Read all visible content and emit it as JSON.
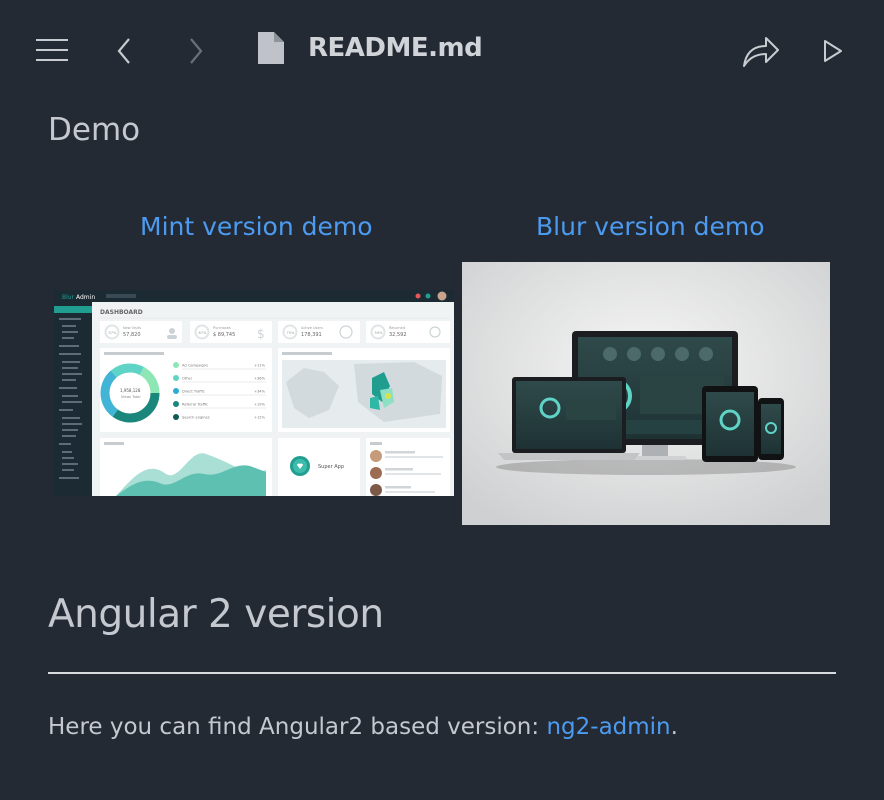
{
  "toolbar": {
    "title": "README.md",
    "icons": [
      "menu-icon",
      "back-icon",
      "forward-icon",
      "file-icon",
      "share-icon",
      "play-icon"
    ]
  },
  "content": {
    "demo_heading": "Demo",
    "mint_link": "Mint version demo",
    "blur_link": "Blur version demo",
    "mint_image": {
      "logo_a": "Blur",
      "logo_b": "Admin",
      "page": "DASHBOARD",
      "stat_cards": [
        {
          "label": "New Visits",
          "value": "57,820",
          "percent": "57%"
        },
        {
          "label": "Purchases",
          "value": "$ 89,745",
          "percent": "67%"
        },
        {
          "label": "Active Users",
          "value": "178,391",
          "percent": "70%"
        },
        {
          "label": "Returned",
          "value": "32,592",
          "percent": "59%"
        }
      ],
      "donut_center_value": "1,958,128",
      "donut_center_label": "Views Total",
      "legend": [
        {
          "label": "Ad Campaigns",
          "value": "+11%"
        },
        {
          "label": "Other",
          "value": "+36%"
        },
        {
          "label": "Direct Traffic",
          "value": "+34%"
        },
        {
          "label": "Referral Traffic",
          "value": "+19%"
        },
        {
          "label": "Search engines",
          "value": "+12%"
        }
      ],
      "promo_label": "Super App",
      "colors": {
        "sidebar": "#1b2a33",
        "accent": "#209e91",
        "background": "#f0f3f4",
        "donut": [
          "#1b867b",
          "#2dacd1",
          "#90b900",
          "#e85656",
          "#17a9cd"
        ]
      }
    },
    "angular_heading": "Angular 2 version",
    "paragraph_text": "Here you can find Angular2 based version: ",
    "paragraph_link": "ng2-admin",
    "paragraph_end": "."
  },
  "colors": {
    "background": "#242a34",
    "link": "#4c9bf0",
    "text": "#c5c9cf"
  }
}
